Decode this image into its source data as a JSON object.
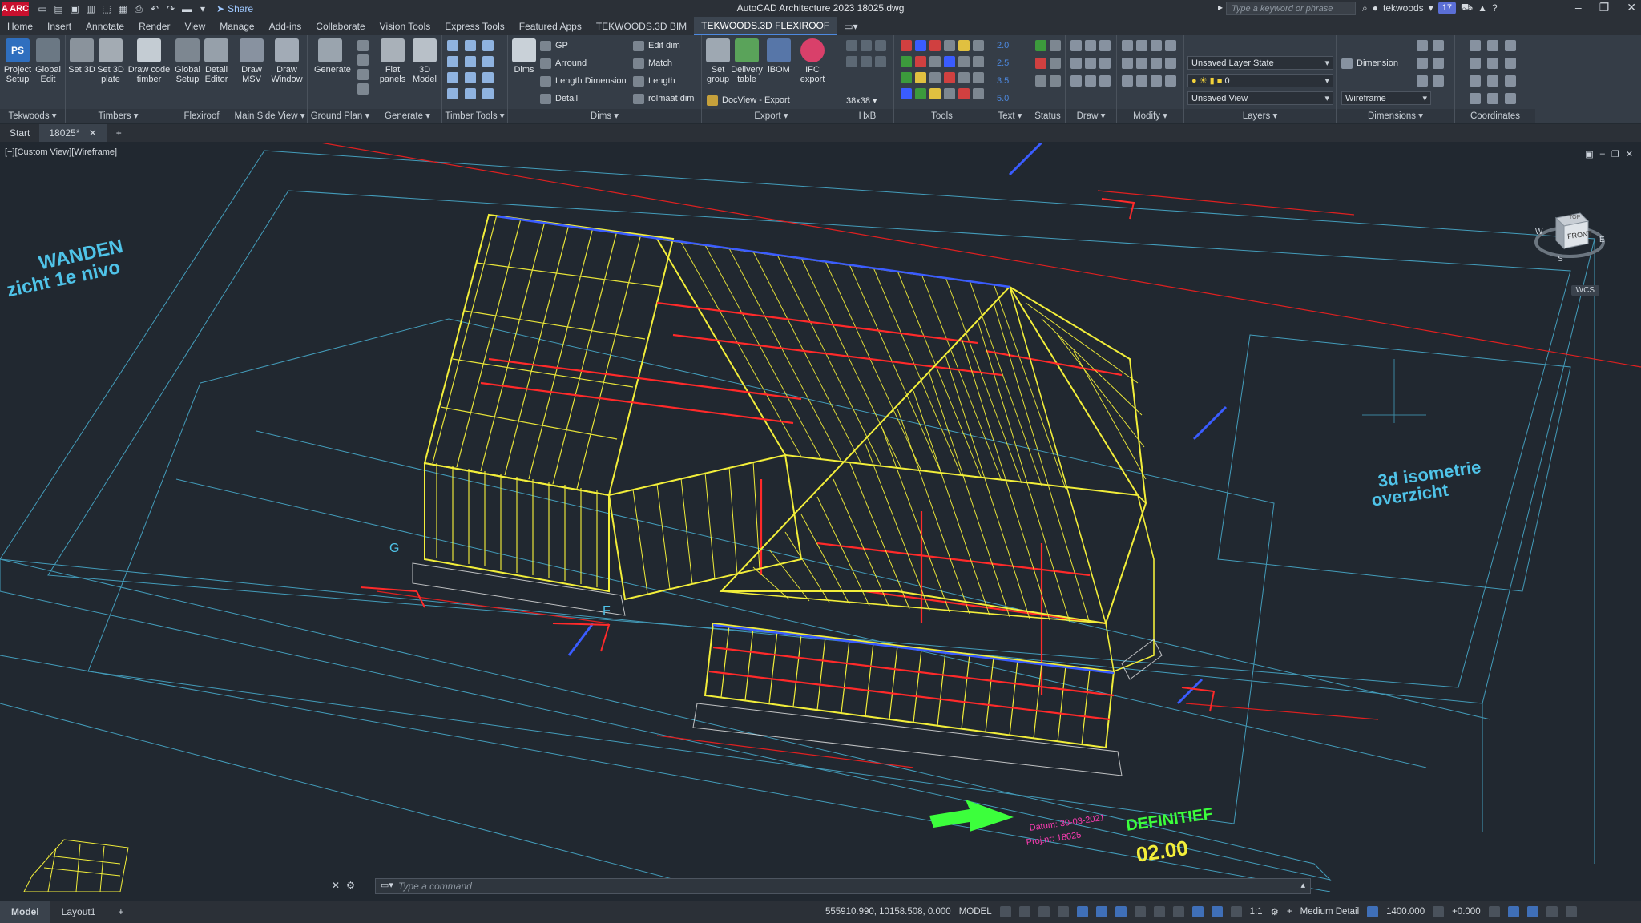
{
  "titlebar": {
    "app_logo": "A ARC",
    "title": "AutoCAD Architecture 2023   18025.dwg",
    "share": "Share",
    "search_placeholder": "Type a keyword or phrase",
    "user": "tekwoods",
    "notifications": "17"
  },
  "menu": {
    "tabs": [
      "Home",
      "Insert",
      "Annotate",
      "Render",
      "View",
      "Manage",
      "Add-ins",
      "Collaborate",
      "Vision Tools",
      "Express Tools",
      "Featured Apps",
      "TEKWOODS.3D BIM",
      "TEKWOODS.3D FLEXIROOF"
    ]
  },
  "ribbon": {
    "tekwoods": {
      "title": "Tekwoods ▾",
      "project_setup": "Project Setup",
      "global_edit": "Global Edit"
    },
    "timbers": {
      "title": "Timbers ▾",
      "set_3d": "Set 3D",
      "set_3d_plate": "Set 3D plate",
      "draw_code_timber": "Draw code timber"
    },
    "flexiroof": {
      "title": "Flexiroof",
      "global_setup": "Global Setup",
      "detail_editor": "Detail Editor"
    },
    "main_side_view": {
      "title": "Main Side View ▾",
      "draw_msv": "Draw MSV",
      "draw_window": "Draw Window"
    },
    "ground_plan": {
      "title": "Ground Plan ▾",
      "generate": "Generate"
    },
    "generate": {
      "title": "Generate ▾",
      "flat_panels": "Flat panels",
      "model_3d": "3D Model"
    },
    "timber_tools": {
      "title": "Timber Tools ▾"
    },
    "dims": {
      "title": "Dims ▾",
      "dims": "Dims",
      "gp": "GP",
      "arround": "Arround",
      "length_dimension": "Length Dimension",
      "detail": "Detail",
      "edit_dim": "Edit dim",
      "match": "Match",
      "length": "Length",
      "rolmaat_dim": "rolmaat dim"
    },
    "export": {
      "title": "Export ▾",
      "set_group": "Set group",
      "delivery_table": "Delivery table",
      "ibom": "iBOM",
      "ifc_export": "IFC export",
      "docview_export": "DocView - Export"
    },
    "hxb": {
      "title": "HxB",
      "size": "38x38 ▾"
    },
    "tools": {
      "title": "Tools"
    },
    "text": {
      "title": "Text ▾",
      "v1": "2.0",
      "v2": "2.5",
      "v3": "3.5",
      "v4": "5.0"
    },
    "status": {
      "title": "Status"
    },
    "draw": {
      "title": "Draw ▾"
    },
    "modify": {
      "title": "Modify ▾"
    },
    "layers": {
      "title": "Layers ▾",
      "layer_state": "Unsaved Layer State",
      "current_layer": "0",
      "view": "Unsaved View"
    },
    "dimensions": {
      "title": "Dimensions ▾",
      "dimension": "Dimension",
      "visual_style": "Wireframe"
    },
    "coordinates": {
      "title": "Coordinates"
    }
  },
  "filetabs": {
    "start": "Start",
    "file": "18025*"
  },
  "viewport": {
    "label": "[−][Custom View][Wireframe]",
    "viewcube_face": "FRONT",
    "viewcube_top": "TOP",
    "compass_w": "W",
    "compass_e": "E",
    "compass_s": "S",
    "wcs": "WCS",
    "text_wanden": "WANDEN",
    "text_zicht": "zicht 1e nivo",
    "text_iso1": "3d isometrie",
    "text_iso2": "overzicht",
    "text_definitief": "DEFINITIEF",
    "text_rev": "02.00",
    "text_datum": "Datum: 30-03-2021",
    "text_projnr": "Proj.nr: 18025",
    "grid_g": "G",
    "grid_f": "F"
  },
  "commandline": {
    "placeholder": "Type a command"
  },
  "statusbar": {
    "model_tab": "Model",
    "layout_tab": "Layout1",
    "coords": "555910.990, 10158.508, 0.000",
    "space": "MODEL",
    "scale": "1:1",
    "detail": "Medium Detail",
    "elevation": "1400.000",
    "offset": "+0.000"
  },
  "colors": {
    "background": "#212830",
    "ribbon": "#353d47",
    "frame_yellow": "#f2ee3a",
    "frame_red": "#ff2a2a",
    "frame_blue": "#3a5cff",
    "cyan_lines": "#4fc3e8",
    "accent_green": "#3cff3c"
  }
}
